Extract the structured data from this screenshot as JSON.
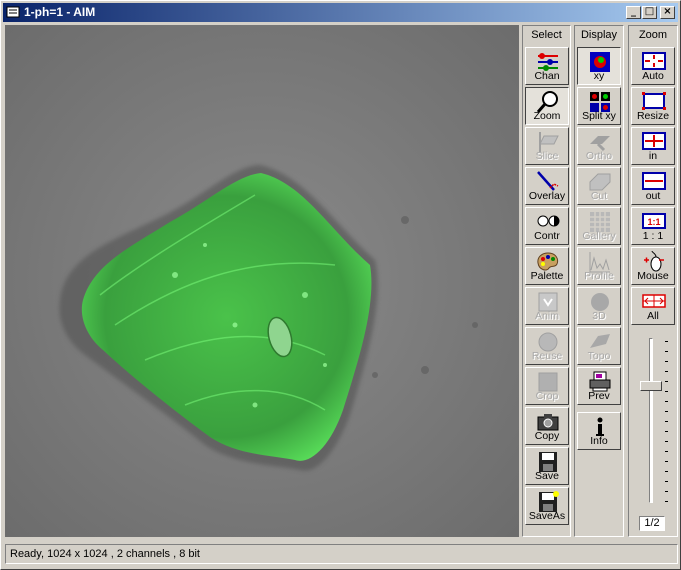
{
  "window": {
    "title": "1-ph=1 - AIM",
    "minimize_glyph": "_",
    "maximize_glyph": "□",
    "close_glyph": "×"
  },
  "panels": {
    "select": {
      "header": "Select",
      "buttons": [
        {
          "label": "Chan",
          "icon": "channel-icon",
          "enabled": true,
          "pressed": false
        },
        {
          "label": "Zoom",
          "icon": "magnifier-icon",
          "enabled": true,
          "pressed": true
        },
        {
          "label": "Slice",
          "icon": "slice-icon",
          "enabled": false,
          "pressed": false
        },
        {
          "label": "Overlay",
          "icon": "overlay-icon",
          "enabled": true,
          "pressed": false
        },
        {
          "label": "Contr",
          "icon": "contrast-icon",
          "enabled": true,
          "pressed": false
        },
        {
          "label": "Palette",
          "icon": "palette-icon",
          "enabled": true,
          "pressed": false
        },
        {
          "label": "Anim",
          "icon": "animation-icon",
          "enabled": false,
          "pressed": false
        },
        {
          "label": "Reuse",
          "icon": "reuse-icon",
          "enabled": false,
          "pressed": false
        },
        {
          "label": "Crop",
          "icon": "crop-icon",
          "enabled": false,
          "pressed": false
        },
        {
          "label": "Copy",
          "icon": "camera-icon",
          "enabled": true,
          "pressed": false
        },
        {
          "label": "Save",
          "icon": "floppy-icon",
          "enabled": true,
          "pressed": false
        },
        {
          "label": "SaveAs",
          "icon": "floppy-as-icon",
          "enabled": true,
          "pressed": false
        }
      ]
    },
    "display": {
      "header": "Display",
      "buttons": [
        {
          "label": "xy",
          "icon": "xy-icon",
          "enabled": true,
          "pressed": true
        },
        {
          "label": "Split xy",
          "icon": "split-xy-icon",
          "enabled": true,
          "pressed": false
        },
        {
          "label": "Ortho",
          "icon": "ortho-icon",
          "enabled": false,
          "pressed": false
        },
        {
          "label": "Cut",
          "icon": "cut-icon",
          "enabled": false,
          "pressed": false
        },
        {
          "label": "Gallery",
          "icon": "gallery-icon",
          "enabled": false,
          "pressed": false
        },
        {
          "label": "Profile",
          "icon": "profile-icon",
          "enabled": false,
          "pressed": false
        },
        {
          "label": "3D",
          "icon": "sphere-icon",
          "enabled": false,
          "pressed": false
        },
        {
          "label": "Topo",
          "icon": "topo-icon",
          "enabled": false,
          "pressed": false
        },
        {
          "label": "Prev",
          "icon": "printer-icon",
          "enabled": true,
          "pressed": false
        },
        {
          "label": "Info",
          "icon": "info-icon",
          "enabled": true,
          "pressed": false
        }
      ]
    },
    "zoom": {
      "header": "Zoom",
      "buttons": [
        {
          "label": "Auto",
          "icon": "zoom-auto-icon",
          "enabled": true,
          "pressed": false
        },
        {
          "label": "Resize",
          "icon": "zoom-resize-icon",
          "enabled": true,
          "pressed": false
        },
        {
          "label": "in",
          "icon": "zoom-in-icon",
          "enabled": true,
          "pressed": false
        },
        {
          "label": "out",
          "icon": "zoom-out-icon",
          "enabled": true,
          "pressed": false
        },
        {
          "label": "1 : 1",
          "icon": "zoom-one-to-one-icon",
          "icon_text": "1:1",
          "enabled": true,
          "pressed": false
        },
        {
          "label": "Mouse",
          "icon": "mouse-icon",
          "enabled": true,
          "pressed": false
        },
        {
          "label": "All",
          "icon": "zoom-all-icon",
          "enabled": true,
          "pressed": false
        }
      ],
      "slider_level": 0.28,
      "value": "1/2"
    }
  },
  "status": "Ready, 1024 x 1024 , 2 channels , 8 bit",
  "colors": {
    "title_active": "#0a246a",
    "face": "#d4d0c8",
    "fluorescence": "#39ff4a"
  }
}
